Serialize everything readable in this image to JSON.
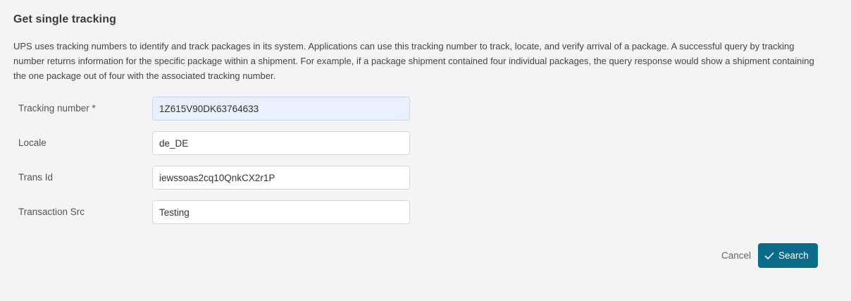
{
  "form": {
    "title": "Get single tracking",
    "description": "UPS uses tracking numbers to identify and track packages in its system. Applications can use this tracking number to track, locate, and verify arrival of a package. A successful query by tracking number returns information for the specific package within a shipment. For example, if a package shipment contained four individual packages, the query response would show a shipment containing the one package out of four with the associated tracking number.",
    "fields": [
      {
        "label": "Tracking number *",
        "value": "1Z615V90DK63764633"
      },
      {
        "label": "Locale",
        "value": "de_DE"
      },
      {
        "label": "Trans Id",
        "value": "iewssoas2cq10QnkCX2r1P"
      },
      {
        "label": "Transaction Src",
        "value": "Testing"
      }
    ]
  },
  "actions": {
    "cancel_label": "Cancel",
    "search_label": "Search",
    "search_icon": "check-icon"
  },
  "colors": {
    "background": "#f3f4f6",
    "primary_button": "#0b6b8a",
    "autofill_input": "#e8f0fe"
  }
}
